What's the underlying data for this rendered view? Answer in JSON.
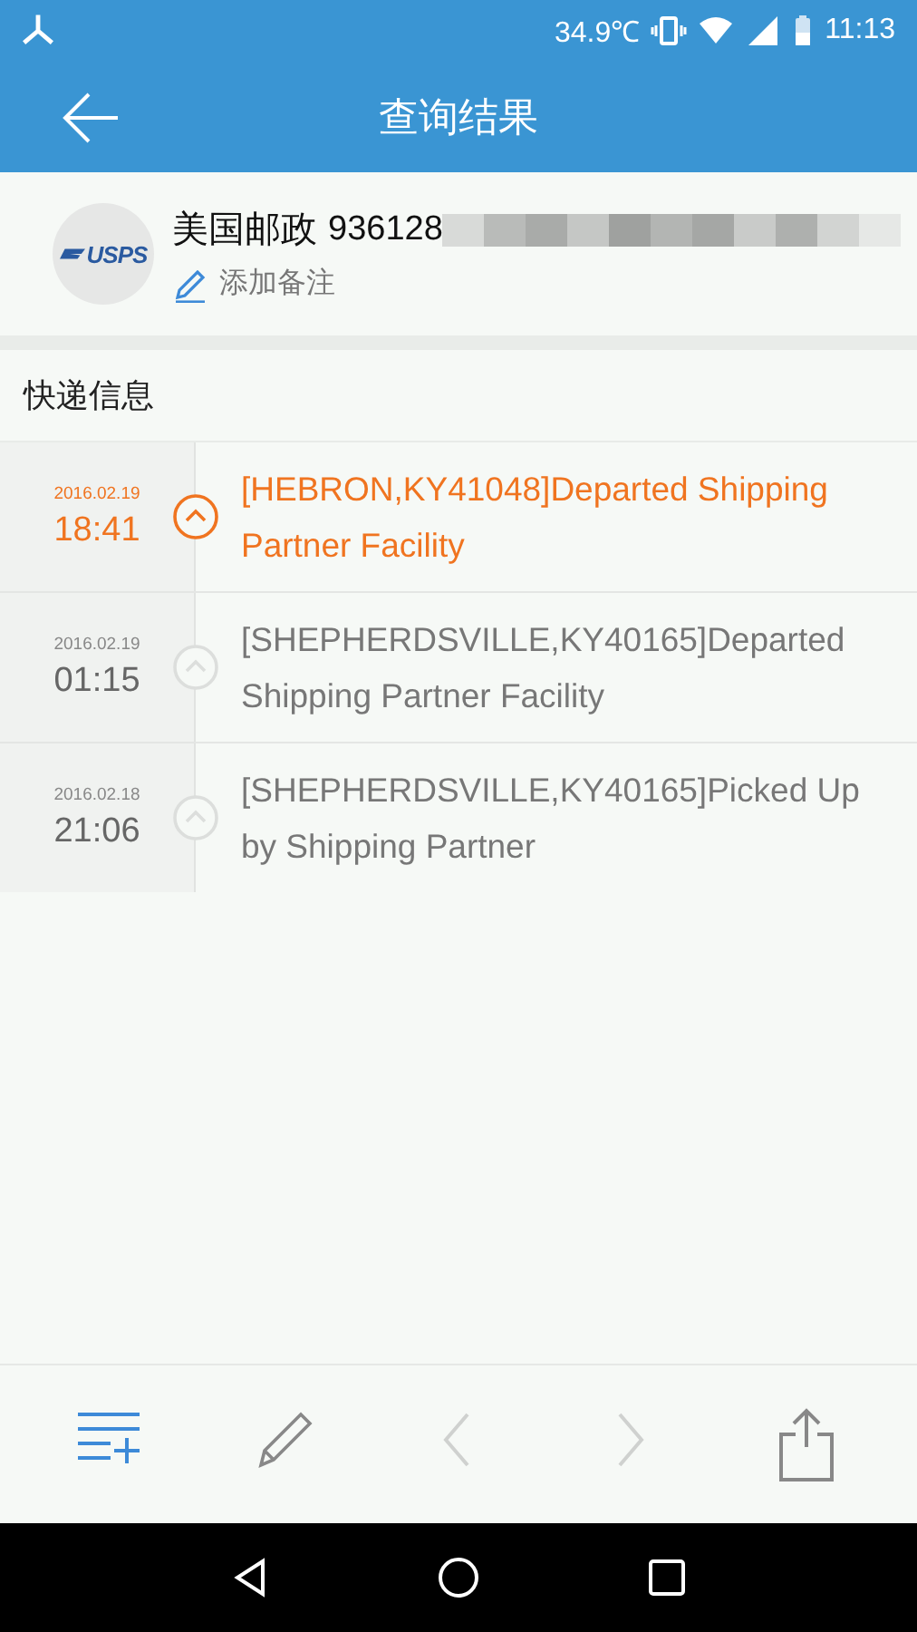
{
  "status_bar": {
    "temperature": "34.9℃",
    "time": "11:13"
  },
  "app_bar": {
    "title": "查询结果"
  },
  "parcel": {
    "carrier_logo": "USPS",
    "carrier": "美国邮政",
    "tracking_number": "936128",
    "note_link": "添加备注"
  },
  "section_title": "快递信息",
  "events": [
    {
      "date": "2016.02.19",
      "time": "18:41",
      "text": "[HEBRON,KY41048]Departed Shipping Partner Facility",
      "current": true
    },
    {
      "date": "2016.02.19",
      "time": "01:15",
      "text": "[SHEPHERDSVILLE,KY40165]Departed Shipping Partner Facility",
      "current": false
    },
    {
      "date": "2016.02.18",
      "time": "21:06",
      "text": "[SHEPHERDSVILLE,KY40165]Picked Up by Shipping Partner",
      "current": false
    }
  ],
  "toolbar": [
    {
      "kind": "list-add",
      "disabled": false
    },
    {
      "kind": "edit",
      "disabled": false
    },
    {
      "kind": "prev",
      "disabled": true
    },
    {
      "kind": "next",
      "disabled": true
    },
    {
      "kind": "share",
      "disabled": false
    }
  ]
}
